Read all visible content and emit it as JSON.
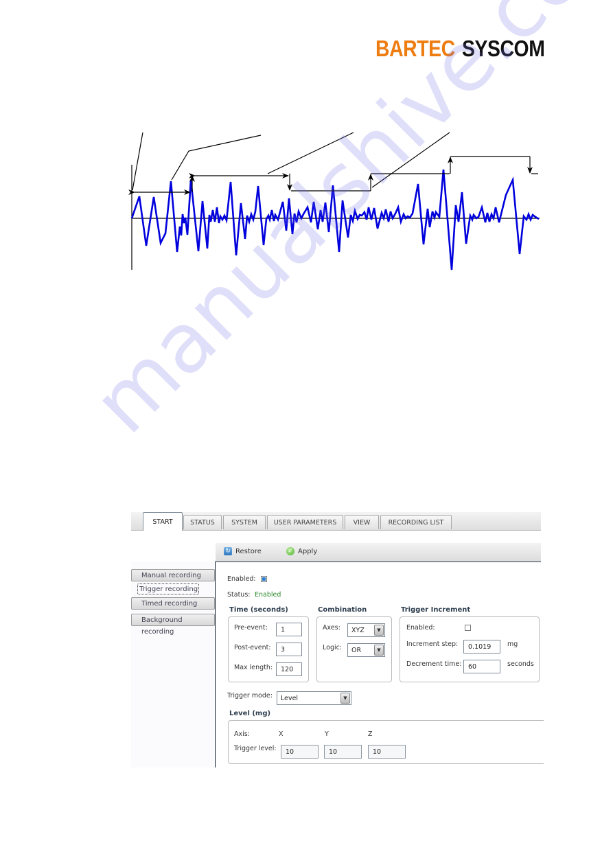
{
  "logo": {
    "part1": "BARTEC",
    "part2": "SYSCOM",
    "color1": "#ee7d11",
    "color2": "#111111"
  },
  "watermark": "manualshive.com",
  "diagram": {
    "type": "annotated-waveform",
    "description": "Triggered vibration waveform with leader lines and stepped trigger-level arrows",
    "signal_color": "#0000dd",
    "annotation_color": "#000000"
  },
  "ui": {
    "tabs": [
      {
        "label": "START",
        "active": true
      },
      {
        "label": "STATUS",
        "active": false
      },
      {
        "label": "SYSTEM",
        "active": false
      },
      {
        "label": "USER PARAMETERS",
        "active": false
      },
      {
        "label": "VIEW",
        "active": false
      },
      {
        "label": "RECORDING LIST",
        "active": false
      }
    ],
    "toolbar": {
      "restore_label": "Restore",
      "apply_label": "Apply"
    },
    "sidebar": [
      {
        "label": "Manual recording",
        "active": false
      },
      {
        "label": "Trigger recording",
        "active": true
      },
      {
        "label": "Timed recording",
        "active": false
      },
      {
        "label": "Background recording",
        "active": false
      }
    ],
    "form": {
      "enabled_label": "Enabled:",
      "enabled_checked": true,
      "status_label": "Status:",
      "status_value": "Enabled",
      "time": {
        "title": "Time (seconds)",
        "pre_event_label": "Pre-event:",
        "pre_event_value": "1",
        "post_event_label": "Post-event:",
        "post_event_value": "3",
        "max_length_label": "Max length:",
        "max_length_value": "120"
      },
      "combination": {
        "title": "Combination",
        "axes_label": "Axes:",
        "axes_value": "XYZ",
        "logic_label": "Logic:",
        "logic_value": "OR"
      },
      "trigger_increment": {
        "title": "Trigger Increment",
        "enabled_label": "Enabled:",
        "enabled_checked": false,
        "increment_step_label": "Increment step:",
        "increment_step_value": "0.1019",
        "increment_step_unit": "mg",
        "decrement_time_label": "Decrement time:",
        "decrement_time_value": "60",
        "decrement_time_unit": "seconds"
      },
      "trigger_mode_label": "Trigger mode:",
      "trigger_mode_value": "Level",
      "level": {
        "title": "Level (mg)",
        "axis_label": "Axis:",
        "axes": [
          "X",
          "Y",
          "Z"
        ],
        "trigger_level_label": "Trigger level:",
        "values": [
          "10",
          "10",
          "10"
        ]
      }
    }
  }
}
